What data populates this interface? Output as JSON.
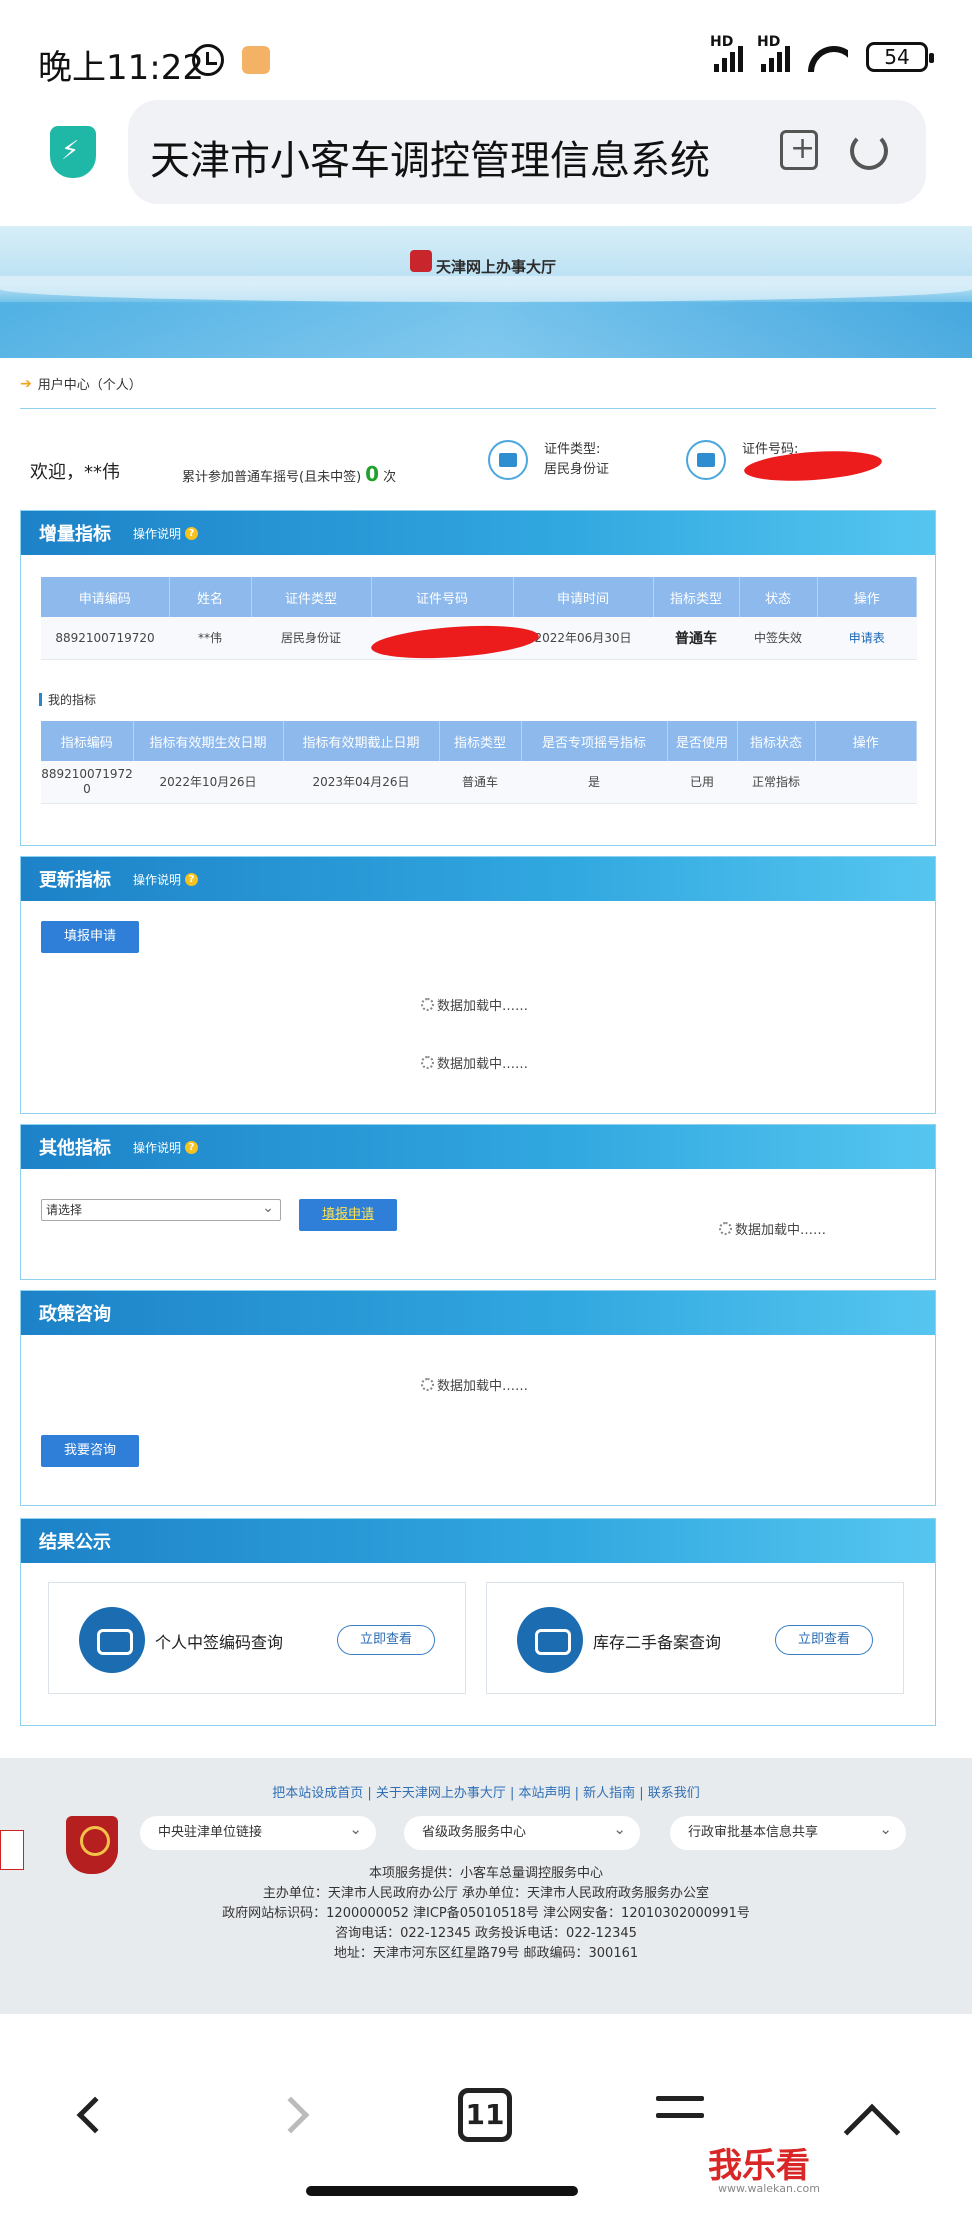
{
  "status_bar": {
    "time": "晚上11:22",
    "signal1": "HD",
    "signal2": "HD",
    "battery": "54"
  },
  "browser": {
    "url_text": "天津市小客车调控管理信息系统",
    "tab_count": "11"
  },
  "banner": {
    "title": "天津网上办事大厅"
  },
  "breadcrumb": "用户中心（个人）",
  "user": {
    "welcome": "欢迎，**伟",
    "lottery_prefix": "累计参加普通车摇号(且未中签)",
    "lottery_count": "0",
    "lottery_suffix": "次",
    "id_type_label": "证件类型:",
    "id_type_value": "居民身份证",
    "id_number_label": "证件号码:"
  },
  "increment_panel": {
    "title": "增量指标",
    "help": "操作说明",
    "headers": [
      "申请编码",
      "姓名",
      "证件类型",
      "证件号码",
      "申请时间",
      "指标类型",
      "状态",
      "操作"
    ],
    "row": [
      "8892100719720",
      "**伟",
      "居民身份证",
      "",
      "2022年06月30日",
      "普通车",
      "中签失效",
      "申请表"
    ],
    "my_quota_title": "我的指标",
    "quota_headers": [
      "指标编码",
      "指标有效期生效日期",
      "指标有效期截止日期",
      "指标类型",
      "是否专项摇号指标",
      "是否使用",
      "指标状态",
      "操作"
    ],
    "quota_row": [
      "8892100719720",
      "2022年10月26日",
      "2023年04月26日",
      "普通车",
      "是",
      "已用",
      "正常指标",
      ""
    ]
  },
  "update_panel": {
    "title": "更新指标",
    "help": "操作说明",
    "button": "填报申请",
    "loading1": "数据加载中……",
    "loading2": "数据加载中……"
  },
  "other_panel": {
    "title": "其他指标",
    "help": "操作说明",
    "select_value": "请选择",
    "button": "填报申请",
    "loading": "数据加载中……"
  },
  "policy_panel": {
    "title": "政策咨询",
    "loading": "数据加载中……",
    "button": "我要咨询"
  },
  "result_panel": {
    "title": "结果公示",
    "card1_label": "个人中签编码查询",
    "card1_button": "立即查看",
    "card2_label": "库存二手备案查询",
    "card2_button": "立即查看"
  },
  "footer": {
    "links": "把本站设成首页 | 关于天津网上办事大厅 | 本站声明 | 新人指南 | 联系我们",
    "select1": "中央驻津单位链接",
    "select2": "省级政务服务中心",
    "select3": "行政审批基本信息共享",
    "line1": "本项服务提供：小客车总量调控服务中心",
    "line2": "主办单位：天津市人民政府办公厅 承办单位：天津市人民政府政务服务办公室",
    "line3": "政府网站标识码：1200000052 津ICP备05010518号 津公网安备：12010302000991号",
    "line4": "咨询电话：022-12345 政务投诉电话：022-12345",
    "line5": "地址：天津市河东区红星路79号 邮政编码：300161"
  },
  "watermark": {
    "text": "我乐看",
    "sub": "www.walekan.com"
  }
}
